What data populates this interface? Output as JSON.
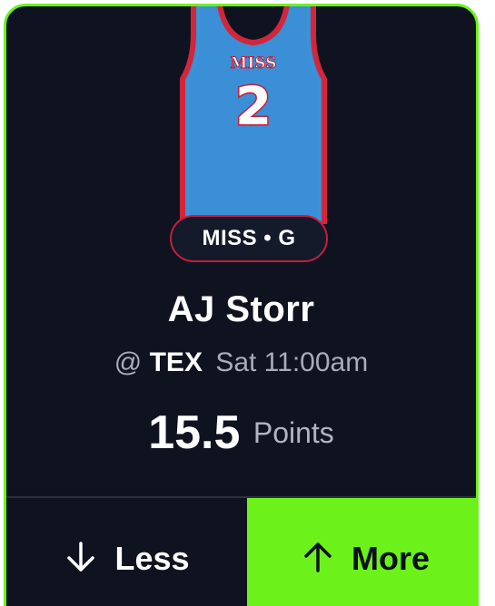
{
  "jersey": {
    "team_text": "MISS",
    "number": "2",
    "colors": {
      "body": "#3a8fd6",
      "trim": "#d3263b",
      "number_fill": "#ffffff",
      "number_outline": "#c41f3a"
    }
  },
  "team_pill": {
    "text": "MISS • G",
    "border_color": "#c41f3a"
  },
  "player": {
    "name": "AJ Storr"
  },
  "game": {
    "prefix": "@",
    "opponent": "TEX",
    "time": "Sat 11:00am"
  },
  "projection": {
    "value": "15.5",
    "stat": "Points"
  },
  "actions": {
    "less_label": "Less",
    "less_icon": "arrow-down-icon",
    "more_label": "More",
    "more_icon": "arrow-up-icon"
  },
  "colors": {
    "accent": "#6cf21a",
    "card_bg": "#0f1320"
  }
}
